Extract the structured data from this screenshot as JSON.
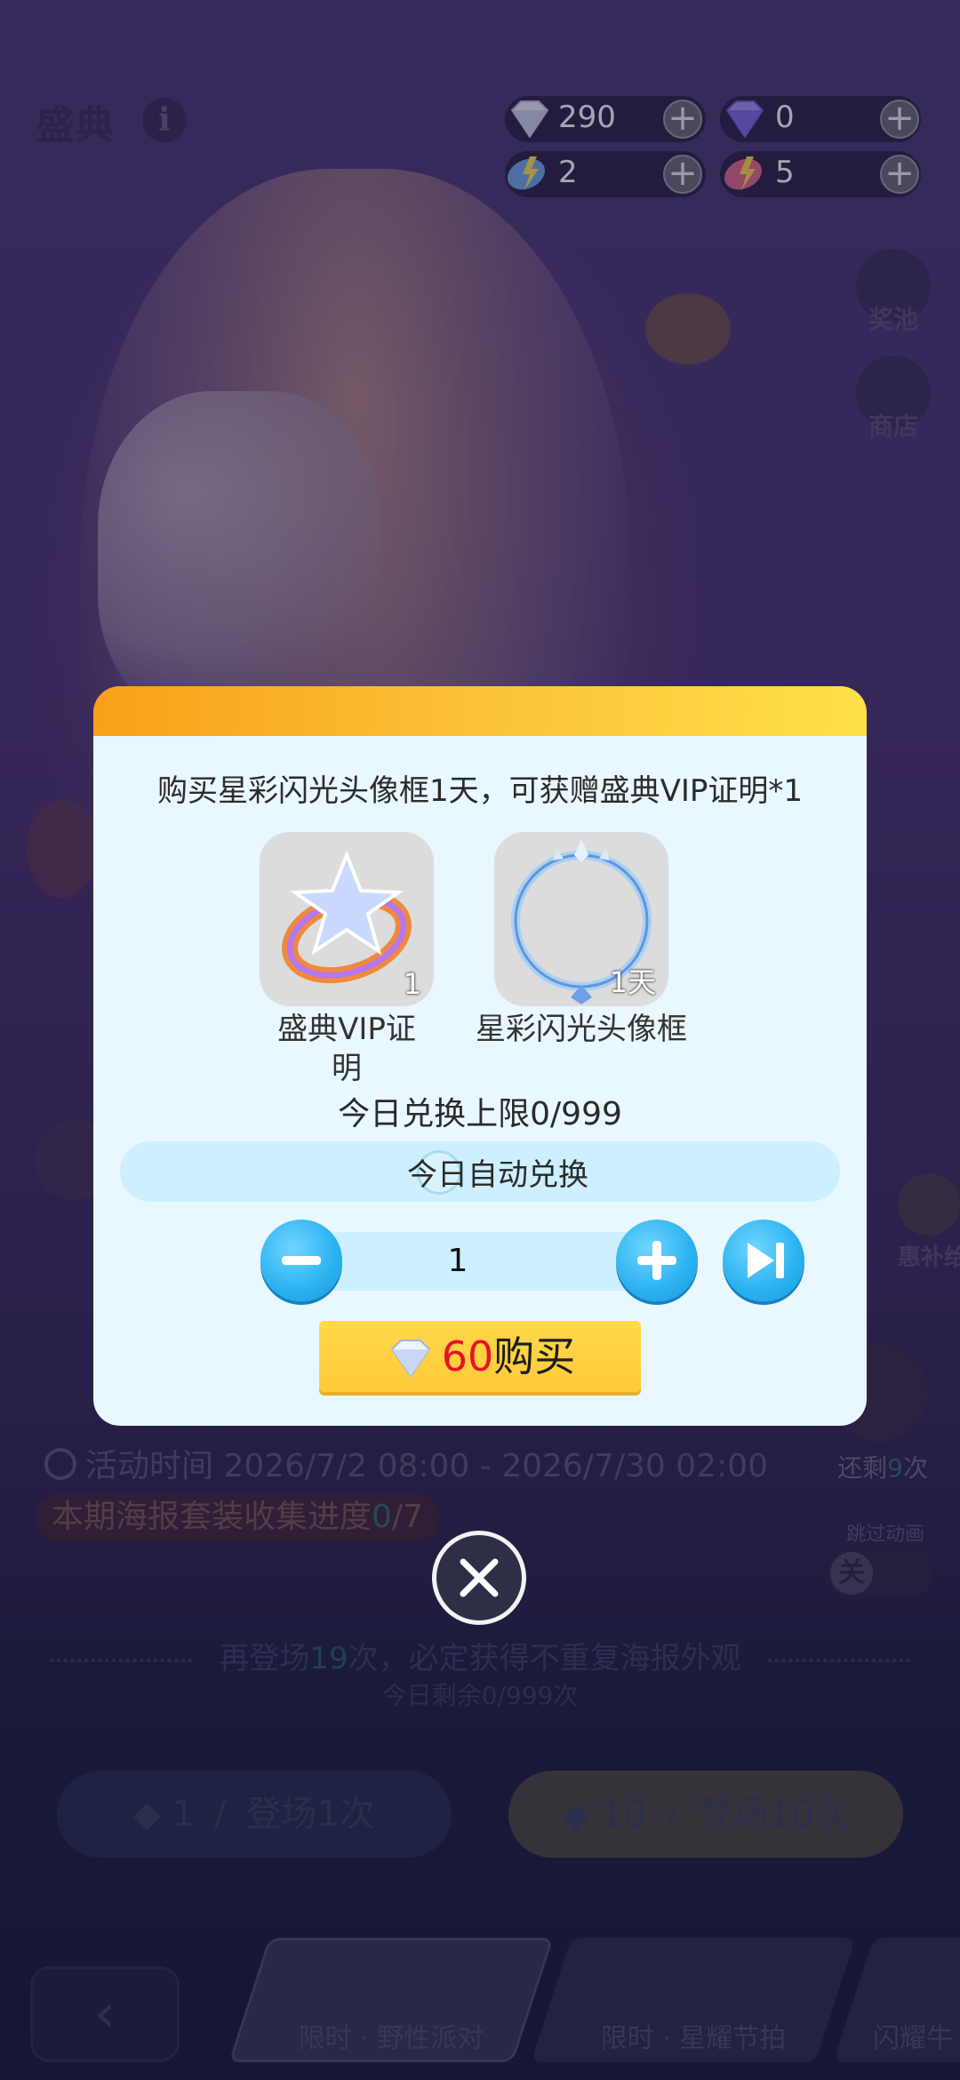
{
  "header": {
    "title": "盛典",
    "currencies": [
      {
        "icon": "white-diamond-icon",
        "value": "290"
      },
      {
        "icon": "purple-diamond-icon",
        "value": "0"
      },
      {
        "icon": "blue-ticket-icon",
        "value": "2"
      },
      {
        "icon": "red-ticket-icon",
        "value": "5"
      }
    ]
  },
  "side": {
    "prize_pool": "奖池",
    "shop": "商店",
    "bonus_partial": "惠补给"
  },
  "event": {
    "time_label": "活动时间 2026/7/2 08:00 - 2026/7/30 02:00",
    "collection_prefix": "本期海报套装收集进度",
    "collection_count": "0",
    "collection_total": "/7",
    "remain_prefix": "还剩",
    "remain_count": "9",
    "remain_suffix": "次",
    "skip_animation": "跳过动画",
    "skip_state": "关",
    "guarantee_prefix": "再登场",
    "guarantee_count": "19",
    "guarantee_suffix": "次，必定获得不重复海报外观",
    "daily_remaining": "今日剩余0/999次"
  },
  "draw": {
    "one": {
      "count": "1",
      "label": "登场1次"
    },
    "ten": {
      "count": "10",
      "label": "登场10次"
    }
  },
  "tabs": [
    {
      "label": "限时 · 野性派对"
    },
    {
      "label": "限时 · 星耀节拍"
    },
    {
      "label": "闪耀牛"
    }
  ],
  "modal": {
    "description": "购买星彩闪光头像框1天，可获赠盛典VIP证明*1",
    "items": [
      {
        "icon": "vip-ring-icon",
        "qty": "1",
        "name": "盛典VIP证明"
      },
      {
        "icon": "avatar-frame-icon",
        "qty": "1天",
        "name": "星彩闪光头像框"
      }
    ],
    "exchange_limit": "今日兑换上限0/999",
    "auto_exchange": "今日自动兑换",
    "quantity": "1",
    "price": "60",
    "buy_label": "购买"
  },
  "colors": {
    "accent_yellow": "#ffd84a",
    "accent_blue": "#2ab1f0",
    "price_red": "#e4142a",
    "modal_bg": "#e9f7ff"
  }
}
